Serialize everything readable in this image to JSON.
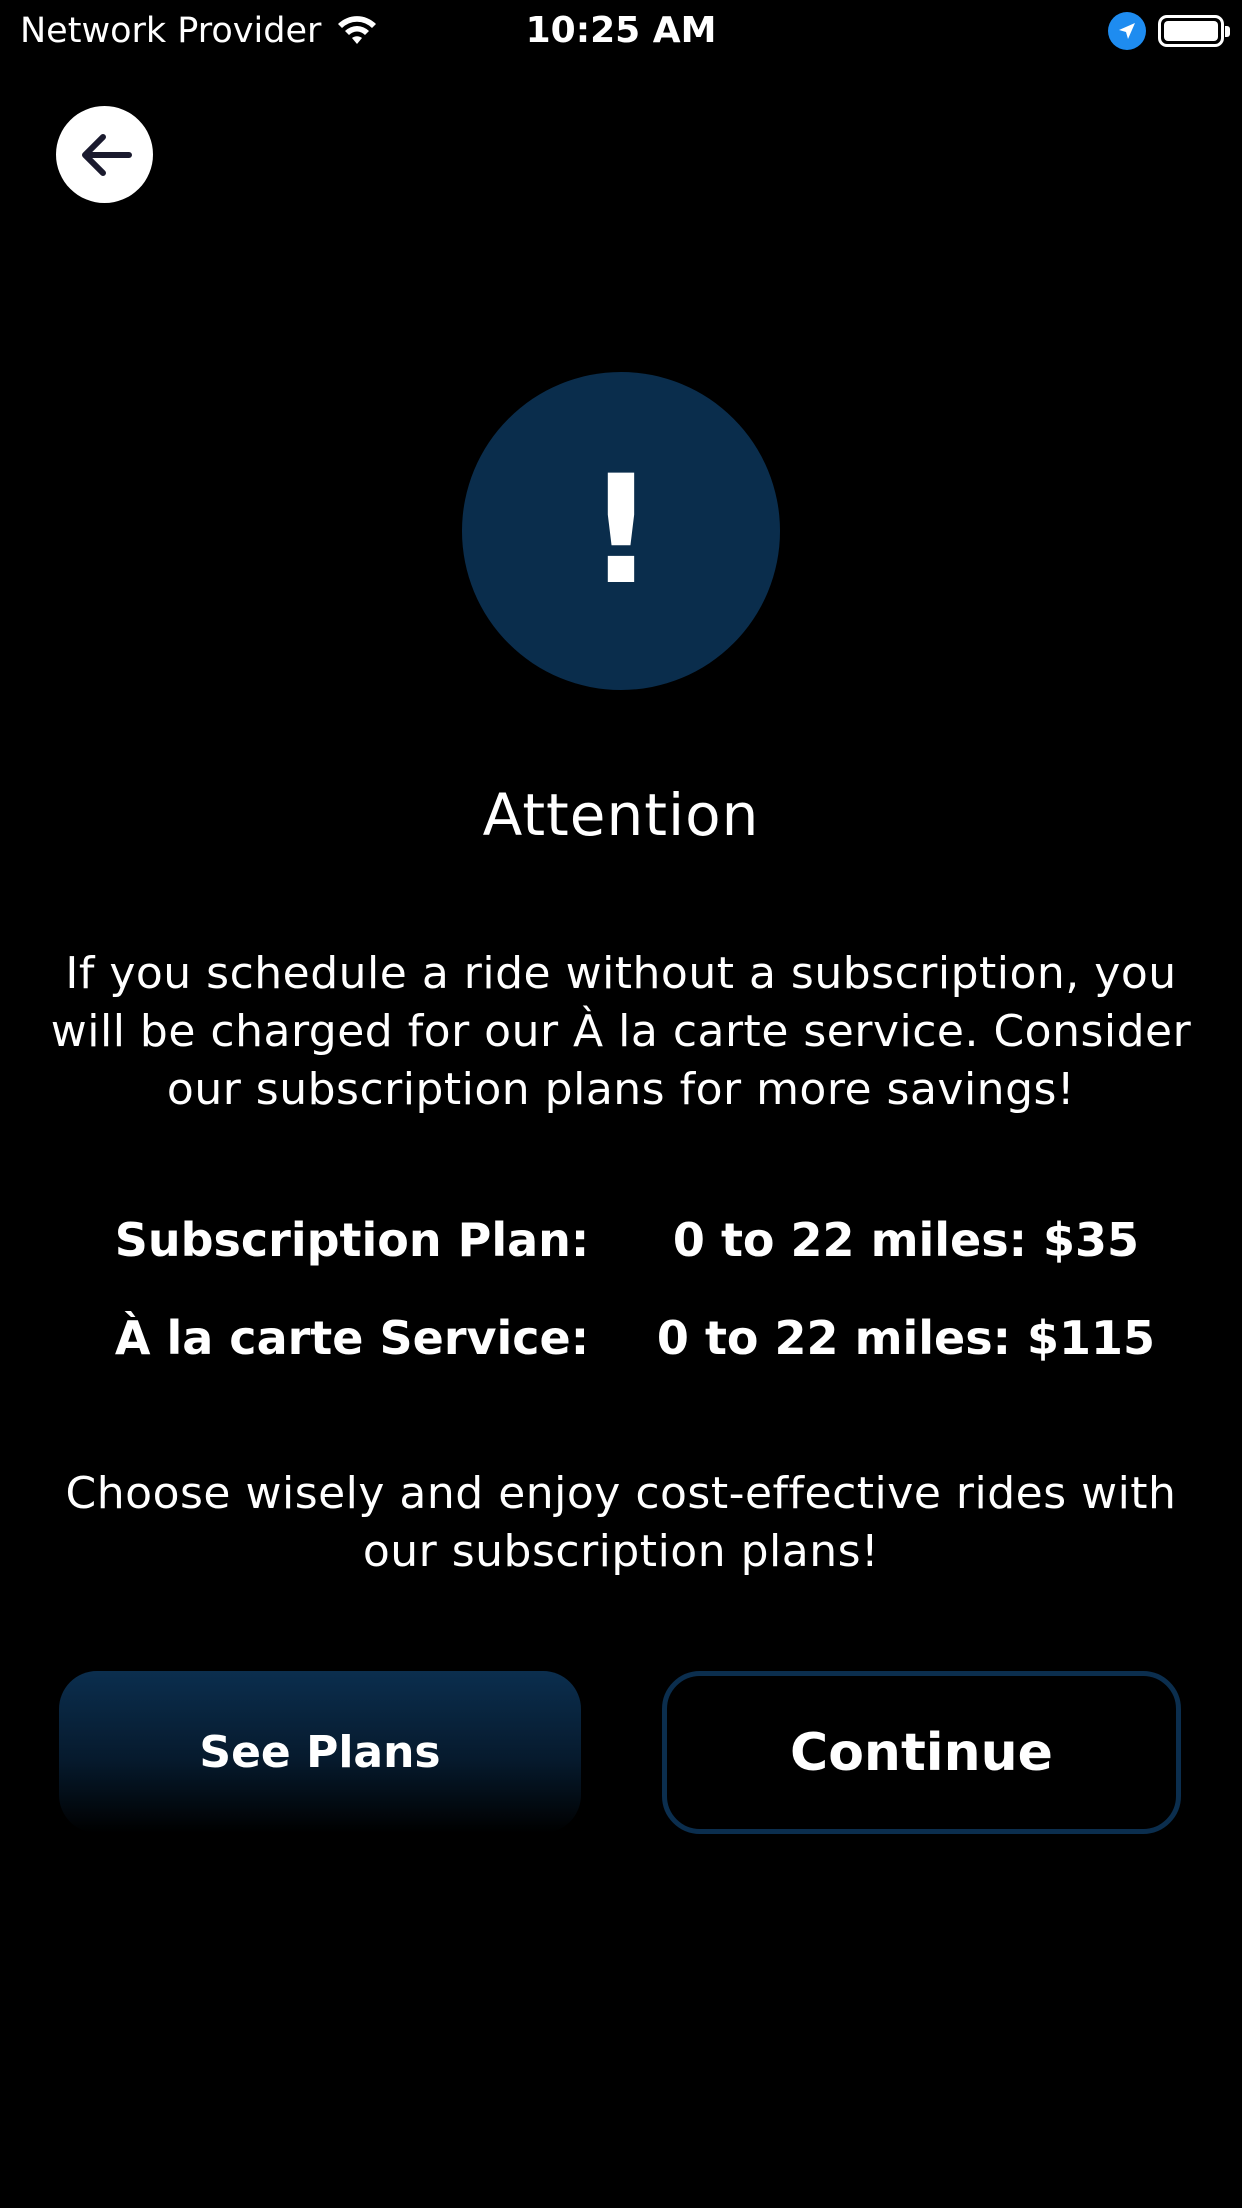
{
  "status_bar": {
    "carrier": "Network Provider",
    "time": "10:25 AM"
  },
  "icons": {
    "back": "arrow-left-icon",
    "wifi": "wifi-icon",
    "location": "location-arrow-icon",
    "battery": "battery-icon",
    "alert": "exclamation-icon"
  },
  "alert": {
    "mark": "!",
    "title": "Attention",
    "message": "If you schedule a ride without a subscription, you will be charged for our À la carte service. Consider our subscription plans for more savings!"
  },
  "pricing": [
    {
      "label": "Subscription Plan:",
      "value": "0 to 22 miles: $35"
    },
    {
      "label": "À la carte Service:",
      "value": "0 to 22 miles: $115"
    }
  ],
  "footer_note": "Choose wisely and enjoy cost-effective rides with our subscription plans!",
  "buttons": {
    "see_plans": "See Plans",
    "continue": "Continue"
  },
  "colors": {
    "background": "#000000",
    "accent": "#0a2d4c",
    "location_blue": "#1e8cf0",
    "text": "#ffffff"
  }
}
